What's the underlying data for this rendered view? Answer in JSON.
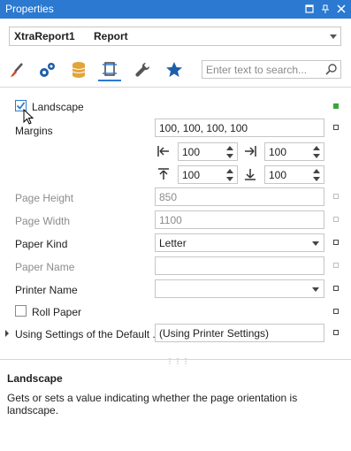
{
  "window": {
    "title": "Properties"
  },
  "report_selector": {
    "name": "XtraReport1",
    "type": "Report"
  },
  "search": {
    "placeholder": "Enter text to search..."
  },
  "toolbar": {
    "icons": [
      "brush-icon",
      "gears-icon",
      "database-icon",
      "page-setup-icon",
      "wrench-icon",
      "star-icon"
    ],
    "active": "page-setup-icon"
  },
  "properties": {
    "landscape": {
      "label": "Landscape",
      "checked": true
    },
    "margins": {
      "label": "Margins",
      "value": "100, 100, 100, 100",
      "left": "100",
      "right": "100",
      "top": "100",
      "bottom": "100"
    },
    "page_height": {
      "label": "Page Height",
      "value": "850"
    },
    "page_width": {
      "label": "Page Width",
      "value": "1100"
    },
    "paper_kind": {
      "label": "Paper Kind",
      "value": "Letter"
    },
    "paper_name": {
      "label": "Paper Name",
      "value": ""
    },
    "printer_name": {
      "label": "Printer Name",
      "value": ""
    },
    "roll_paper": {
      "label": "Roll Paper",
      "checked": false
    },
    "using_settings": {
      "label": "Using Settings of the Default ...",
      "value": "(Using Printer Settings)"
    }
  },
  "description": {
    "title": "Landscape",
    "text": "Gets or sets a value indicating whether the page orientation is landscape."
  },
  "colors": {
    "accent": "#2b79d0",
    "modified_marker": "#3aa63a"
  }
}
